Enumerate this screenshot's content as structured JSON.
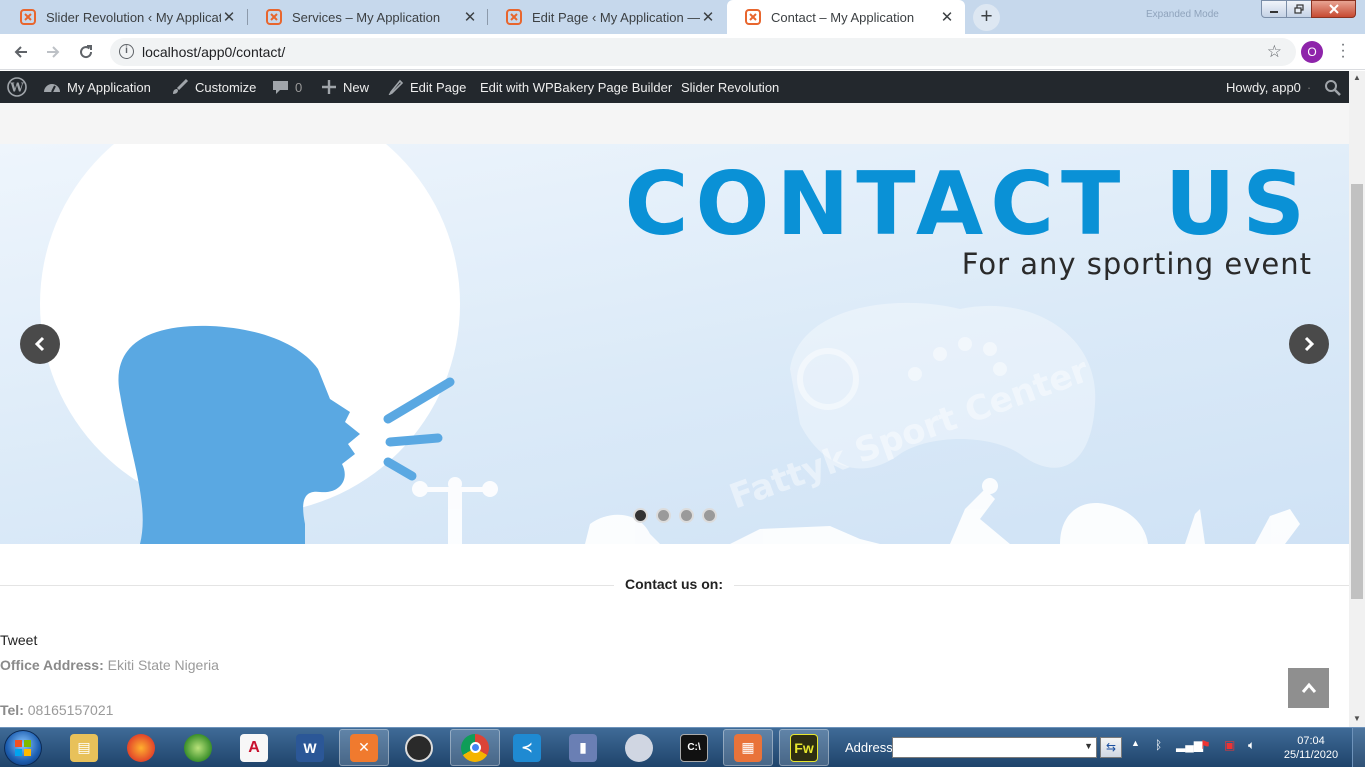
{
  "browser": {
    "tabs": [
      {
        "title": "Slider Revolution ‹ My Applicatio",
        "active": false
      },
      {
        "title": "Services – My Application",
        "active": false
      },
      {
        "title": "Edit Page ‹ My Application — Wo",
        "active": false
      },
      {
        "title": "Contact – My Application",
        "active": true
      }
    ],
    "new_tab_glyph": "+",
    "close_glyph": "✕",
    "profile_faded": "Expanded Mode",
    "url": "localhost/app0/contact/",
    "avatar_letter": "O",
    "colors": {
      "tab_strip": "#c6d8ec",
      "favicon": "#e8662e"
    }
  },
  "adminbar": {
    "site_name": "My Application",
    "customize": "Customize",
    "comments_count": "0",
    "new_label": "New",
    "edit_page": "Edit Page",
    "wpbakery": "Edit with WPBakery Page Builder",
    "slider_revolution": "Slider Revolution",
    "howdy": "Howdy, app0",
    "icons": [
      "wordpress-icon",
      "dashboard-icon",
      "paintbrush-icon",
      "comment-icon",
      "plus-icon",
      "pencil-icon",
      "search-icon"
    ]
  },
  "slider": {
    "heading": "CONTACT US",
    "subheading": "For any sporting event",
    "watermark": "Fattyk Sport Center",
    "bullets": 4,
    "active_bullet": 1,
    "colors": {
      "heading": "#0a91d6",
      "figure": "#5aa8e2"
    }
  },
  "content": {
    "separator_title": "Contact us on:",
    "tweet": "Tweet",
    "office_label": "Office Address:",
    "office_value": "Ekiti State Nigeria",
    "tel_label": "Tel:",
    "tel_value": "08165157021"
  },
  "taskbar": {
    "address_label": "Address",
    "clock_time": "07:04",
    "clock_date": "25/11/2020",
    "apps": [
      "explorer",
      "firefox",
      "network",
      "acrobat",
      "word",
      "xampp",
      "obs",
      "chrome",
      "vscode",
      "phpstorm",
      "games",
      "cmd",
      "gallery",
      "fireworks"
    ]
  }
}
